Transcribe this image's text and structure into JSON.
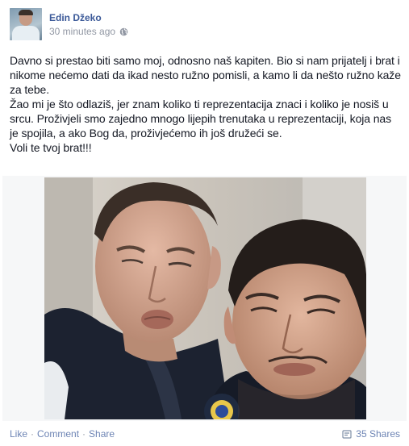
{
  "post": {
    "author_name": "Edin Džeko",
    "timestamp": "30 minutes ago",
    "privacy_icon": "globe-icon",
    "paragraphs": [
      "Davno si prestao biti samo moj, odnosno naš kapiten. Bio si nam prijatelj i brat i nikome nećemo dati da ikad nesto ružno pomisli, a kamo li da nešto ružno kaže za tebe.",
      "Žao mi je što odlaziš, jer znam koliko ti reprezentacija znaci i koliko je nosiš u srcu. Proživjeli smo zajedno mnogo lijepih trenutaka u reprezentaciji, koja nas je spojila, a ako Bog da, proživjećemo ih još družeći se.",
      "Voli te tvoj brat!!!"
    ]
  },
  "footer": {
    "like_label": "Like",
    "comment_label": "Comment",
    "share_label": "Share",
    "separator": "·",
    "shares_count": "35 Shares"
  },
  "colors": {
    "link_blue": "#3b5998",
    "action_blue": "#6d84b4",
    "meta_gray": "#9197a3",
    "body_text": "#141823"
  }
}
